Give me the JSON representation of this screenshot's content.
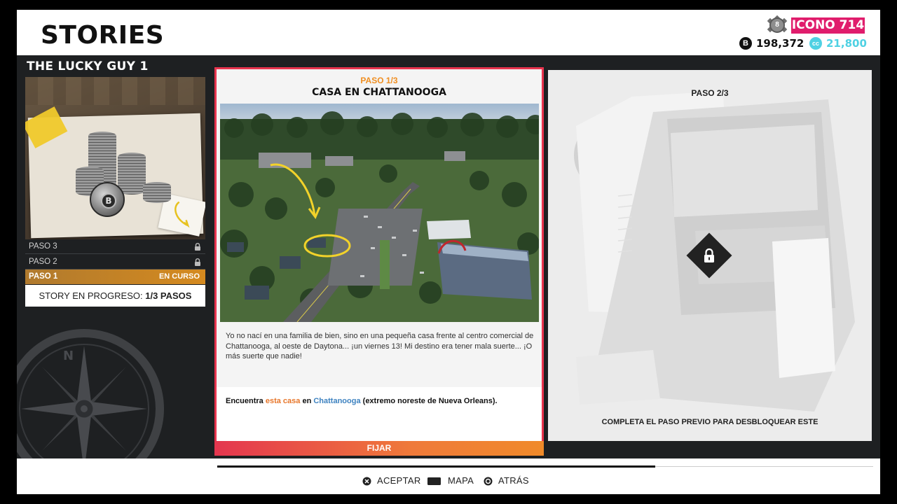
{
  "header": {
    "title": "STORIES",
    "rank_level": "8",
    "icono_label": "ICONO 714",
    "bucks_symbol": "B",
    "bucks": "198,372",
    "cc_symbol": "cc",
    "cc": "21,800",
    "colors": {
      "icono": "#e01d6c",
      "cc": "#4fd1e3"
    }
  },
  "story": {
    "title": "THE LUCKY GUY 1",
    "steps": [
      {
        "label": "PASO 3",
        "locked": true
      },
      {
        "label": "PASO 2",
        "locked": true
      },
      {
        "label": "PASO 1",
        "status": "EN CURSO",
        "active": true
      }
    ],
    "progress_label": "STORY EN PROGRESO: ",
    "progress_value": "1/3 PASOS"
  },
  "active_card": {
    "step": "PASO 1/3",
    "title": "CASA EN CHATTANOOGA",
    "description": "Yo no nací en una familia de bien, sino en una pequeña casa frente al centro comercial de Chattanooga, al oeste de Daytona... ¡un viernes 13! Mi destino era tener mala suerte... ¡O más suerte que nadie!",
    "objective": {
      "prefix": "Encuentra ",
      "highlight1": "esta casa",
      "middle": " en ",
      "highlight2": "Chattanooga",
      "suffix": " (extremo noreste de Nueva Orleans)."
    },
    "pin_label": "FIJAR",
    "colors": {
      "border": "#e8344e",
      "step": "#ef8f22"
    }
  },
  "locked_card": {
    "step": "PASO 2/3",
    "message": "COMPLETA EL PASO PREVIO PARA DESBLOQUEAR ESTE"
  },
  "footer": {
    "hints": [
      {
        "icon": "cross-button-icon",
        "label": "ACEPTAR"
      },
      {
        "icon": "touchpad-icon",
        "label": "MAPA"
      },
      {
        "icon": "circle-button-icon",
        "label": "ATRÁS"
      }
    ]
  }
}
